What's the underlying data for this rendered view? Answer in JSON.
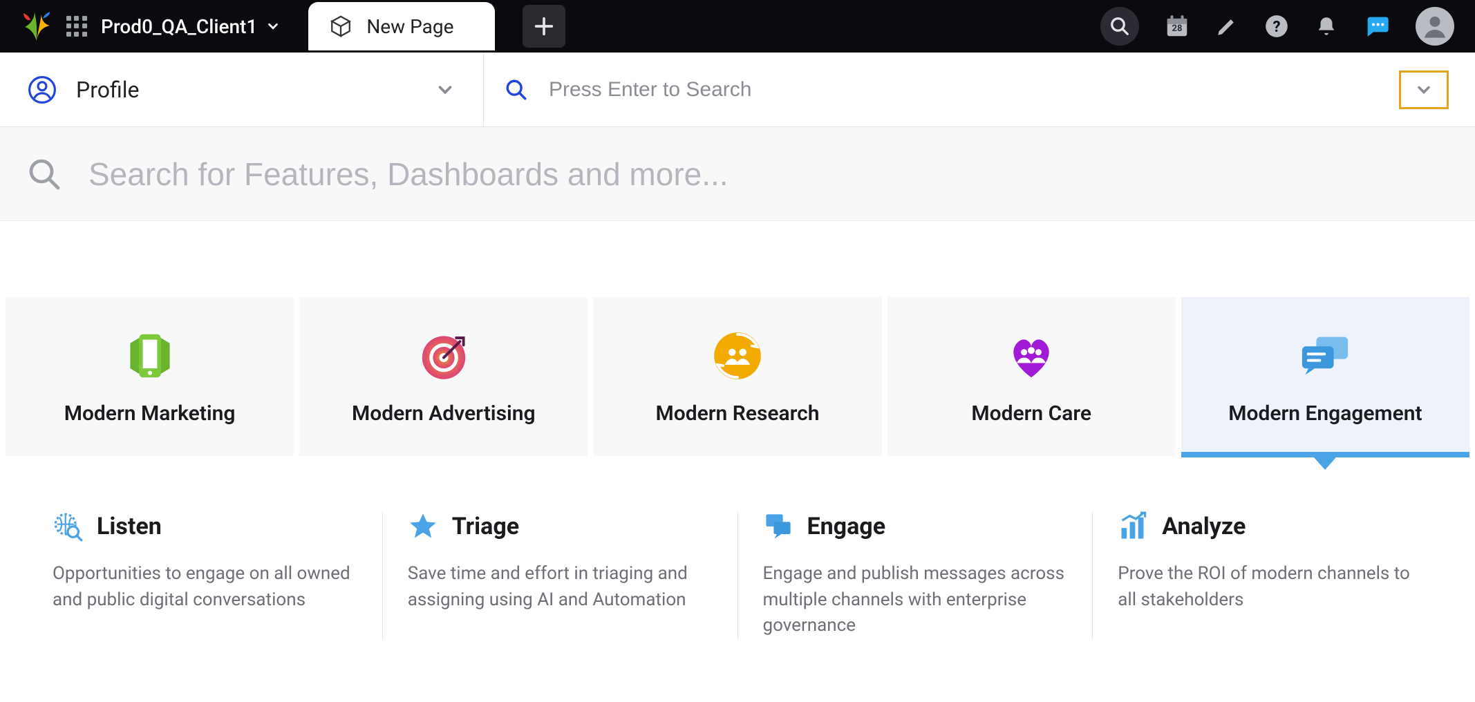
{
  "topbar": {
    "client_name": "Prod0_QA_Client1",
    "tab_label": "New Page",
    "calendar_day": "28"
  },
  "subbar": {
    "profile_label": "Profile",
    "search_placeholder": "Press Enter to Search"
  },
  "bigsearch": {
    "placeholder": "Search for Features, Dashboards and more..."
  },
  "categories": [
    {
      "label": "Modern Marketing"
    },
    {
      "label": "Modern Advertising"
    },
    {
      "label": "Modern Research"
    },
    {
      "label": "Modern Care"
    },
    {
      "label": "Modern Engagement"
    }
  ],
  "selected_category_index": 4,
  "features": [
    {
      "title": "Listen",
      "desc": "Opportunities to engage on all owned and public digital conversations"
    },
    {
      "title": "Triage",
      "desc": "Save time and effort in triaging and assigning using AI and Automation"
    },
    {
      "title": "Engage",
      "desc": "Engage and publish messages across multiple channels with enterprise governance"
    },
    {
      "title": "Analyze",
      "desc": "Prove the ROI of modern channels to all stakeholders"
    }
  ]
}
